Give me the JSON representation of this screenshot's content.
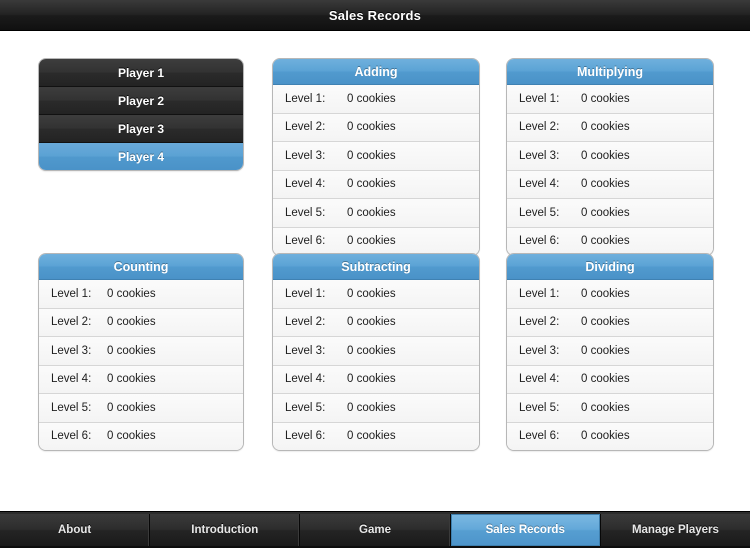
{
  "navbar": {
    "title": "Sales Records"
  },
  "players": {
    "items": [
      {
        "label": "Player 1",
        "selected": false
      },
      {
        "label": "Player 2",
        "selected": false
      },
      {
        "label": "Player 3",
        "selected": false
      },
      {
        "label": "Player 4",
        "selected": true
      }
    ]
  },
  "tables": {
    "counting": {
      "title": "Counting",
      "rows": [
        {
          "level": "Level 1:",
          "value": "0 cookies"
        },
        {
          "level": "Level 2:",
          "value": "0 cookies"
        },
        {
          "level": "Level 3:",
          "value": "0 cookies"
        },
        {
          "level": "Level 4:",
          "value": "0 cookies"
        },
        {
          "level": "Level 5:",
          "value": "0 cookies"
        },
        {
          "level": "Level 6:",
          "value": "0 cookies"
        }
      ]
    },
    "adding": {
      "title": "Adding",
      "rows": [
        {
          "level": "Level 1:",
          "value": "0 cookies"
        },
        {
          "level": "Level 2:",
          "value": "0 cookies"
        },
        {
          "level": "Level 3:",
          "value": "0 cookies"
        },
        {
          "level": "Level 4:",
          "value": "0 cookies"
        },
        {
          "level": "Level 5:",
          "value": "0 cookies"
        },
        {
          "level": "Level 6:",
          "value": "0 cookies"
        }
      ]
    },
    "subtracting": {
      "title": "Subtracting",
      "rows": [
        {
          "level": "Level 1:",
          "value": "0 cookies"
        },
        {
          "level": "Level 2:",
          "value": "0 cookies"
        },
        {
          "level": "Level 3:",
          "value": "0 cookies"
        },
        {
          "level": "Level 4:",
          "value": "0 cookies"
        },
        {
          "level": "Level 5:",
          "value": "0 cookies"
        },
        {
          "level": "Level 6:",
          "value": "0 cookies"
        }
      ]
    },
    "multiplying": {
      "title": "Multiplying",
      "rows": [
        {
          "level": "Level 1:",
          "value": "0 cookies"
        },
        {
          "level": "Level 2:",
          "value": "0 cookies"
        },
        {
          "level": "Level 3:",
          "value": "0 cookies"
        },
        {
          "level": "Level 4:",
          "value": "0 cookies"
        },
        {
          "level": "Level 5:",
          "value": "0 cookies"
        },
        {
          "level": "Level 6:",
          "value": "0 cookies"
        }
      ]
    },
    "dividing": {
      "title": "Dividing",
      "rows": [
        {
          "level": "Level 1:",
          "value": "0 cookies"
        },
        {
          "level": "Level 2:",
          "value": "0 cookies"
        },
        {
          "level": "Level 3:",
          "value": "0 cookies"
        },
        {
          "level": "Level 4:",
          "value": "0 cookies"
        },
        {
          "level": "Level 5:",
          "value": "0 cookies"
        },
        {
          "level": "Level 6:",
          "value": "0 cookies"
        }
      ]
    }
  },
  "tabbar": {
    "tabs": [
      {
        "label": "About",
        "active": false
      },
      {
        "label": "Introduction",
        "active": false
      },
      {
        "label": "Game",
        "active": false
      },
      {
        "label": "Sales Records",
        "active": true
      },
      {
        "label": "Manage Players",
        "active": false
      }
    ]
  },
  "colors": {
    "accent_blue": "#5ba3d5",
    "accent_blue_dark": "#4a92c8",
    "bar_dark": "#232323",
    "row_bg": "#f7f7f7"
  }
}
